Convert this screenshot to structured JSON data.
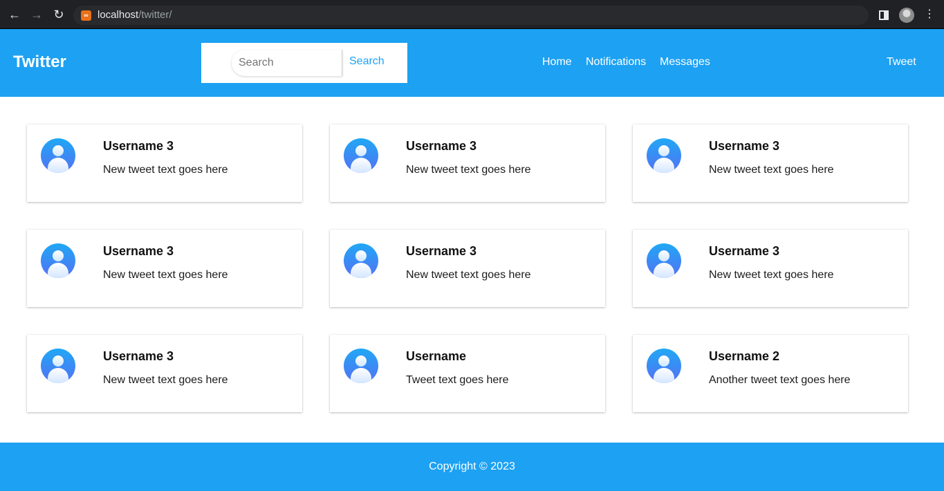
{
  "browser": {
    "url_host": "localhost",
    "url_path": "/twitter/",
    "back_icon": "back-arrow-icon",
    "forward_icon": "forward-arrow-icon",
    "reload_icon": "reload-icon"
  },
  "header": {
    "brand": "Twitter",
    "search": {
      "placeholder": "Search",
      "button_label": "Search"
    },
    "nav": [
      "Home",
      "Notifications",
      "Messages"
    ],
    "tweet_label": "Tweet",
    "color": "#1da1f2"
  },
  "tweets": [
    {
      "username": "Username 3",
      "text": "New tweet text goes here"
    },
    {
      "username": "Username 3",
      "text": "New tweet text goes here"
    },
    {
      "username": "Username 3",
      "text": "New tweet text goes here"
    },
    {
      "username": "Username 3",
      "text": "New tweet text goes here"
    },
    {
      "username": "Username 3",
      "text": "New tweet text goes here"
    },
    {
      "username": "Username 3",
      "text": "New tweet text goes here"
    },
    {
      "username": "Username 3",
      "text": "New tweet text goes here"
    },
    {
      "username": "Username",
      "text": "Tweet text goes here"
    },
    {
      "username": "Username 2",
      "text": "Another tweet text goes here"
    }
  ],
  "footer": {
    "copyright": "Copyright © 2023"
  }
}
